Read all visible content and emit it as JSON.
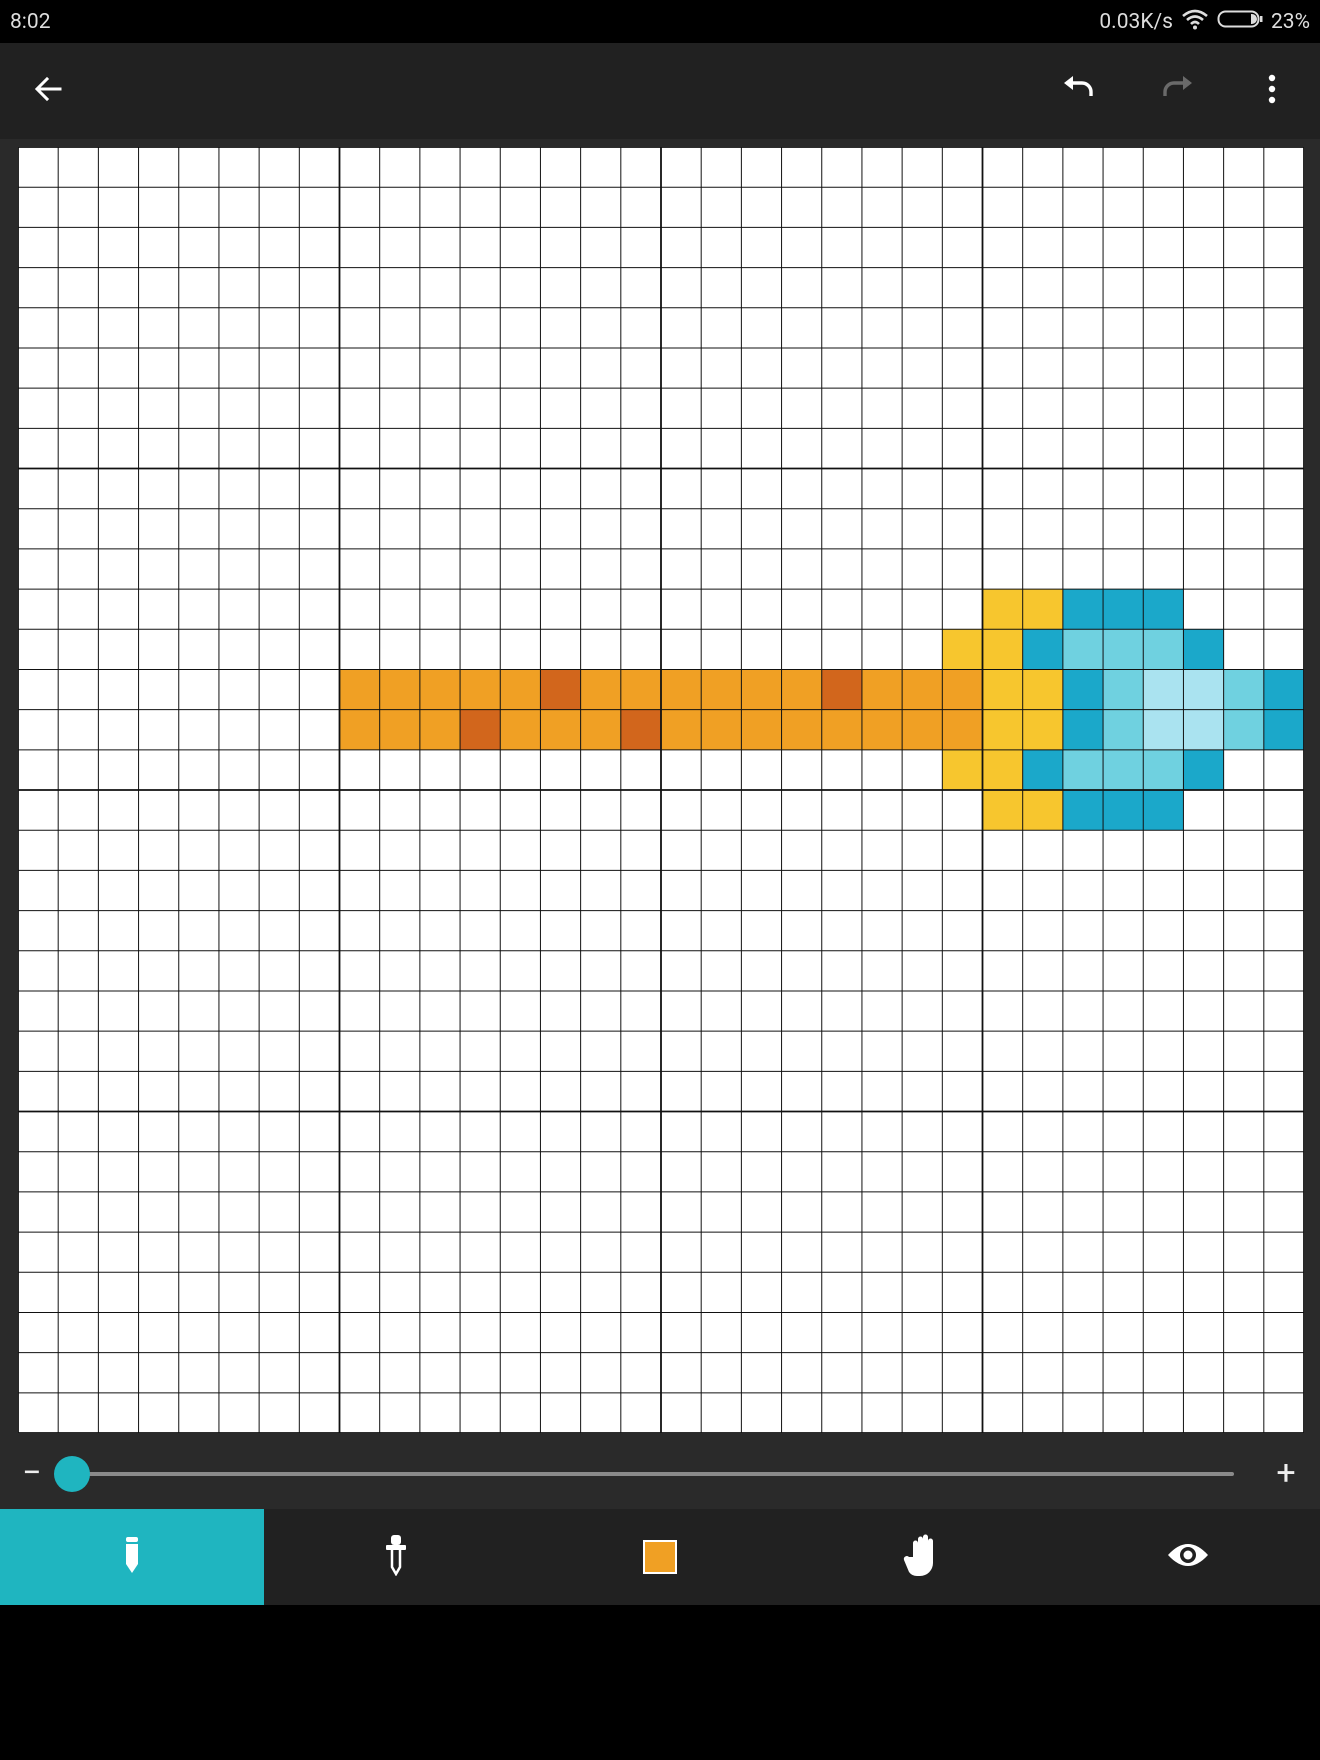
{
  "status_bar": {
    "time": "8:02",
    "network_speed": "0.03K/s",
    "battery": "23%",
    "icons": [
      "wifi-icon",
      "battery-icon"
    ]
  },
  "app_bar": {
    "icons": [
      "back-arrow-icon",
      "undo-icon",
      "redo-icon",
      "more-vert-icon"
    ]
  },
  "canvas": {
    "columns": 32,
    "rows": 32,
    "major_every": 8,
    "colors": {
      "O": "#F0A024",
      "D": "#D2661C",
      "Y": "#F7C62E",
      "B": "#1BA8CA",
      "L": "#6FD1E0",
      "P": "#AAE3F0"
    },
    "pixels": [
      {
        "row": 11,
        "start": 24,
        "cells": "YYBBB"
      },
      {
        "row": 12,
        "start": 23,
        "cells": "YYBLLLB"
      },
      {
        "row": 13,
        "start": 8,
        "cells": "OOOOODOOOOOODOOOYYBLPPLB"
      },
      {
        "row": 14,
        "start": 8,
        "cells": "OOODOOODOOOOOOOOYYBLPPLB"
      },
      {
        "row": 15,
        "start": 23,
        "cells": "YYBLLLB"
      },
      {
        "row": 16,
        "start": 24,
        "cells": "YYBBB"
      }
    ]
  },
  "zoom": {
    "minus_label": "−",
    "plus_label": "+",
    "level": 0
  },
  "toolbar": {
    "tools": [
      {
        "icon": "pencil-icon",
        "active": true
      },
      {
        "icon": "eyedropper-icon",
        "active": false
      },
      {
        "icon": "color-swatch-icon",
        "color": "#F0A024",
        "active": false
      },
      {
        "icon": "hand-pan-icon",
        "active": false
      },
      {
        "icon": "eye-preview-icon",
        "active": false
      }
    ]
  }
}
